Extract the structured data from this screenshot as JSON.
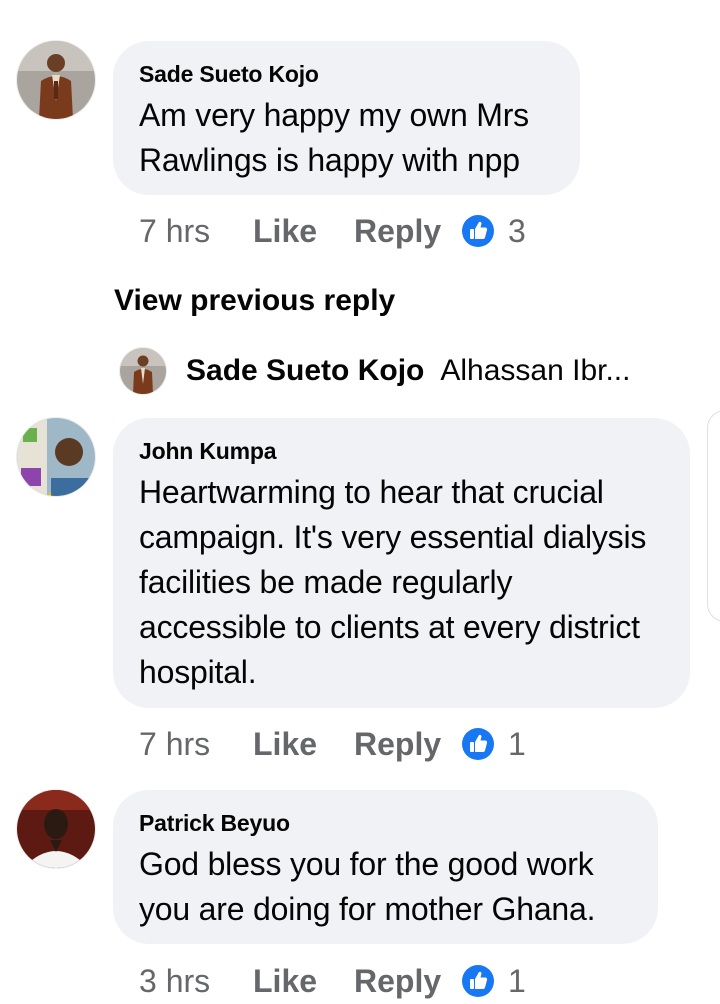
{
  "comments": [
    {
      "author": "Sade Sueto Kojo",
      "text": "Am very happy my own Mrs Rawlings is happy with npp",
      "time": "7 hrs",
      "like_label": "Like",
      "reply_label": "Reply",
      "reaction_count": "3"
    },
    {
      "author": "John Kumpa",
      "text": "Heartwarming to hear that crucial campaign. It's very essential dialysis facilities be made regularly accessible to clients at every district hospital.",
      "time": "7 hrs",
      "like_label": "Like",
      "reply_label": "Reply",
      "reaction_count": "1"
    },
    {
      "author": "Patrick Beyuo",
      "text": "God bless you for the good work you are  doing for mother Ghana.",
      "time": "3 hrs",
      "like_label": "Like",
      "reply_label": "Reply",
      "reaction_count": "1"
    }
  ],
  "thread": {
    "view_previous_label": "View previous reply",
    "reply_author": "Sade Sueto Kojo",
    "reply_snippet": "Alhassan Ibr..."
  },
  "colors": {
    "bubble": "#f0f2f5",
    "secondary_text": "#65676b",
    "like_blue": "#1877f2"
  },
  "icons": {
    "reaction": "like-thumb-icon"
  }
}
